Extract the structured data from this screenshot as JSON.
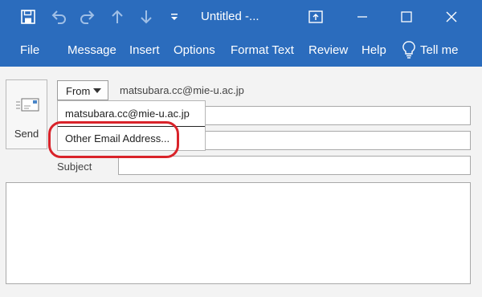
{
  "window": {
    "title": "Untitled  -..."
  },
  "quick_access": {
    "save_icon": "save-icon",
    "undo_icon": "undo-icon",
    "redo_icon": "redo-icon",
    "up_icon": "arrow-up-icon",
    "down_icon": "arrow-down-icon",
    "customize_icon": "customize-toolbar-icon"
  },
  "ribbon": {
    "tabs": [
      "File",
      "Message",
      "Insert",
      "Options",
      "Format Text",
      "Review",
      "Help"
    ],
    "tell_me": "Tell me"
  },
  "compose": {
    "send_label": "Send",
    "from_label": "From",
    "from_address": "matsubara.cc@mie-u.ac.jp",
    "subject_label": "Subject",
    "subject_value": "",
    "body": ""
  },
  "from_dropdown": {
    "options": [
      "matsubara.cc@mie-u.ac.jp",
      "Other Email Address..."
    ]
  },
  "colors": {
    "titlebar": "#2b6cbd",
    "highlight": "#d9232a"
  }
}
